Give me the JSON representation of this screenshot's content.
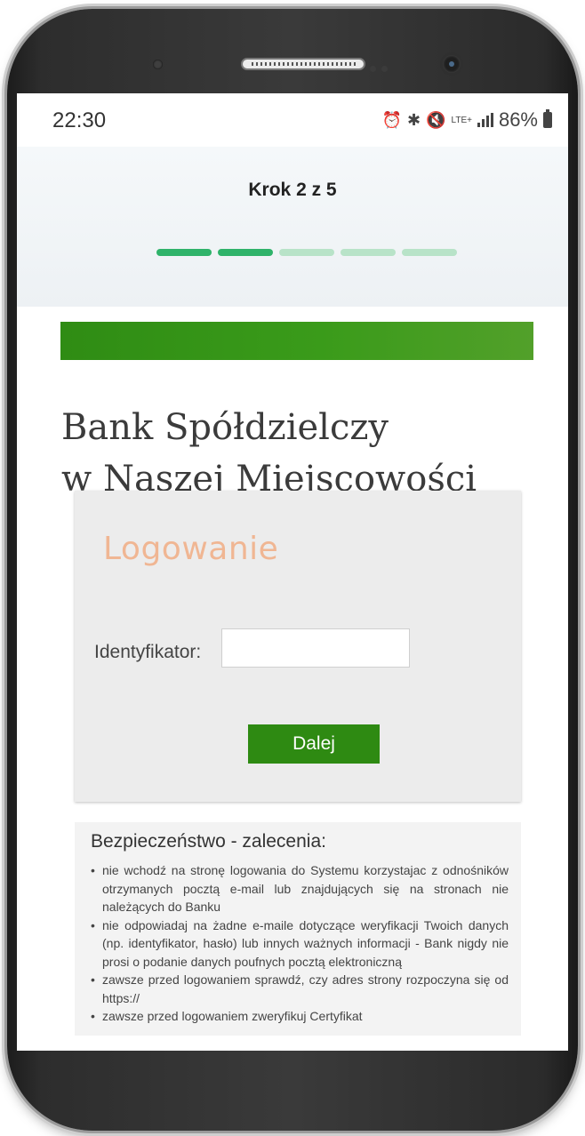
{
  "statusbar": {
    "time": "22:30",
    "icons": [
      "alarm-icon",
      "bluetooth-icon",
      "mute-icon",
      "lte-icon",
      "signal-icon"
    ],
    "lte_label": "LTE+",
    "battery": "86%"
  },
  "stepper": {
    "title": "Krok 2 z 5",
    "current_step": 2,
    "total_steps": 5,
    "done_color": "#2fb36a",
    "pending_color": "#b8e3c8"
  },
  "bank": {
    "brand_color": "#2f8c14",
    "name_line1": "Bank Spółdzielczy",
    "name_line2": "w Naszej Miejscowości"
  },
  "login": {
    "title": "Logowanie",
    "id_label": "Identyfikator:",
    "id_value": "",
    "submit_label": "Dalej"
  },
  "security": {
    "title": "Bezpieczeństwo - zalecenia:",
    "items": [
      "nie wchodź na stronę logowania do Systemu korzystajac z odnośników otrzymanych pocztą e-mail lub znajdujących się na stronach nie należących do Banku",
      "nie odpowiadaj na żadne e-maile dotyczące weryfikacji Twoich danych (np. identyfikator, hasło) lub innych ważnych informacji - Bank nigdy nie prosi o podanie danych poufnych pocztą elektroniczną",
      "zawsze przed logowaniem sprawdź, czy adres strony rozpoczyna się od https://",
      "zawsze przed logowaniem zweryfikuj Certyfikat"
    ]
  }
}
